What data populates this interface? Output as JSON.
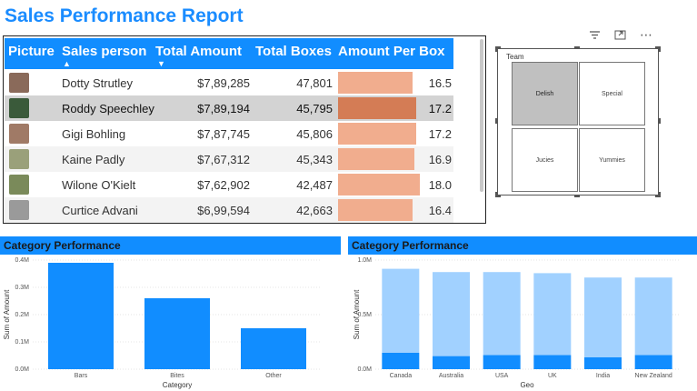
{
  "report": {
    "title": "Sales Performance Report"
  },
  "table": {
    "headers": {
      "picture": "Picture",
      "sales_person": "Sales person",
      "total_amount": "Total Amount",
      "total_boxes": "Total Boxes",
      "amount_per_box": "Amount Per Box"
    },
    "rows": [
      {
        "name": "Dotty Strutley",
        "amount": "$7,89,285",
        "boxes": "47,801",
        "per_box": "16.5",
        "per_box_value": 16.5,
        "avatar_color": "#8a6a5a"
      },
      {
        "name": "Roddy Speechley",
        "amount": "$7,89,194",
        "boxes": "45,795",
        "per_box": "17.2",
        "per_box_value": 17.2,
        "avatar_color": "#3a5a3a",
        "selected": true
      },
      {
        "name": "Gigi Bohling",
        "amount": "$7,87,745",
        "boxes": "45,806",
        "per_box": "17.2",
        "per_box_value": 17.2,
        "avatar_color": "#a07a66"
      },
      {
        "name": "Kaine Padly",
        "amount": "$7,67,312",
        "boxes": "45,343",
        "per_box": "16.9",
        "per_box_value": 16.9,
        "avatar_color": "#9aa07a"
      },
      {
        "name": "Wilone O'Kielt",
        "amount": "$7,62,902",
        "boxes": "42,487",
        "per_box": "18.0",
        "per_box_value": 18.0,
        "avatar_color": "#7a8a5a"
      },
      {
        "name": "Curtice Advani",
        "amount": "$6,99,594",
        "boxes": "42,663",
        "per_box": "16.4",
        "per_box_value": 16.4,
        "avatar_color": "#9a9a9a"
      }
    ]
  },
  "team": {
    "label": "Team",
    "tiles": [
      "Delish",
      "Special",
      "Jucies",
      "Yummies"
    ],
    "selected": "Delish"
  },
  "charts": [
    {
      "title": "Category Performance",
      "chart_data": {
        "type": "bar",
        "categories": [
          "Bars",
          "Bites",
          "Other"
        ],
        "values": [
          0.39,
          0.26,
          0.15
        ],
        "xlabel": "Category",
        "ylabel": "Sum of Amount",
        "yticks": [
          "0.0M",
          "0.1M",
          "0.2M",
          "0.3M",
          "0.4M"
        ],
        "ylim": [
          0,
          0.4
        ],
        "color": "#118dff"
      }
    },
    {
      "title": "Category Performance",
      "chart_data": {
        "type": "bar",
        "categories": [
          "Canada",
          "Australia",
          "USA",
          "UK",
          "India",
          "New Zealand"
        ],
        "series": [
          {
            "values": [
              0.15,
              0.12,
              0.13,
              0.13,
              0.11,
              0.13
            ],
            "color": "#118dff"
          },
          {
            "values": [
              0.77,
              0.77,
              0.76,
              0.75,
              0.73,
              0.71
            ],
            "color": "#a1d1ff"
          }
        ],
        "xlabel": "Geo",
        "ylabel": "Sum of Amount",
        "yticks": [
          "0.0M",
          "0.5M",
          "1.0M"
        ],
        "ylim": [
          0,
          1.0
        ]
      }
    }
  ]
}
